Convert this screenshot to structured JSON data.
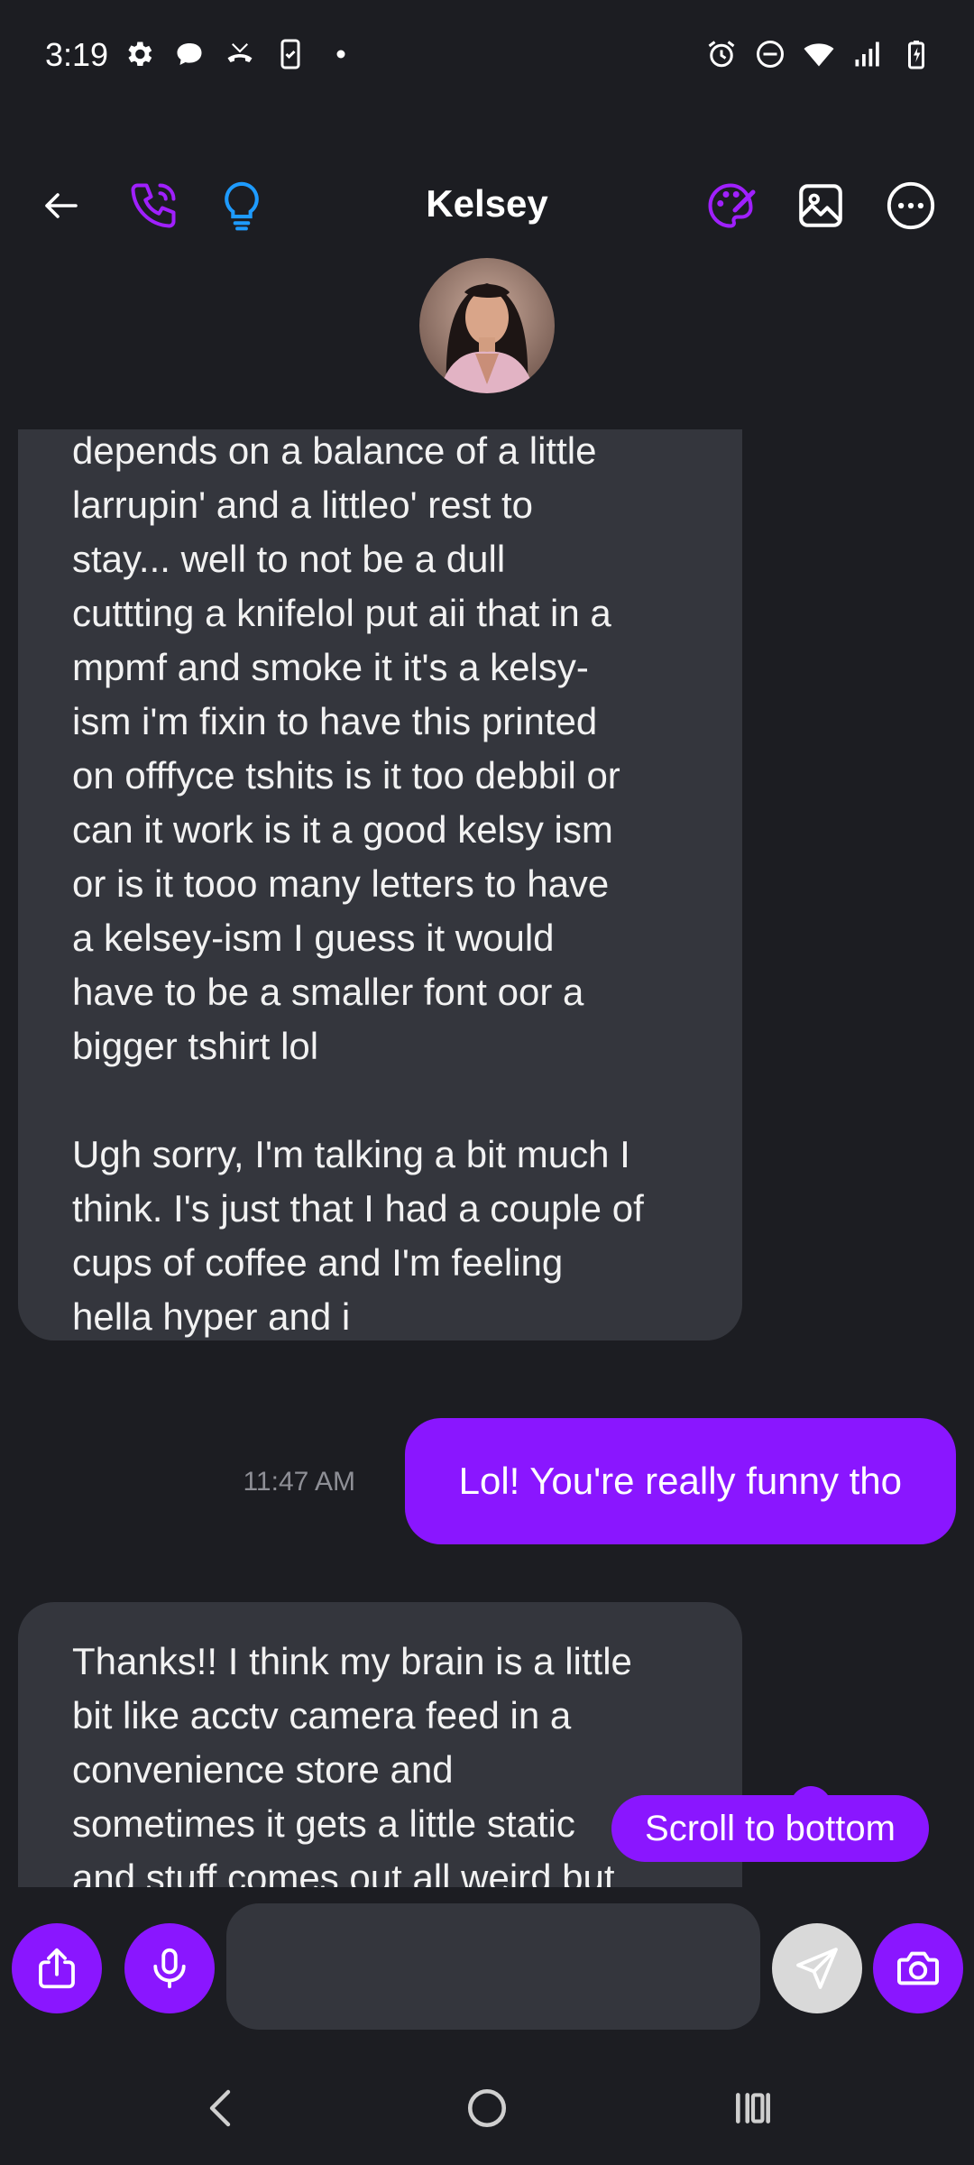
{
  "status_bar": {
    "time": "3:19",
    "left_icons": [
      "gear-icon",
      "chat-bubble-icon",
      "missed-call-icon",
      "phone-clipboard-icon",
      "dot-icon"
    ],
    "right_icons": [
      "alarm-icon",
      "dnd-icon",
      "wifi-icon",
      "signal-icon",
      "battery-charging-icon"
    ]
  },
  "header": {
    "title": "Kelsey",
    "icons": [
      "back-arrow-icon",
      "phone-call-icon",
      "lightbulb-icon",
      "palette-icon",
      "image-icon",
      "more-options-icon"
    ]
  },
  "messages": [
    {
      "direction": "incoming",
      "paragraphs": [
        "depends on a balance of a little\nlarrupin' and a littleo' rest to\nstay... well to not be a dull\ncuttting a knifelol put aii that in a\nmpmf and smoke it it's a kelsy-\nism i'm fixin to have this printed\non offfyce tshits is it too debbil or\ncan it work is it a good kelsy ism\nor is it tooo many letters to have\na kelsey-ism I guess it would\nhave to be a smaller font oor a\nbigger tshirt lol",
        "Ugh sorry, I'm talking a bit much I\nthink. I's just that I had a couple of\ncups of coffee and I'm feeling\nhella hyper and i"
      ]
    },
    {
      "direction": "outgoing",
      "text": "Lol! You're really funny tho",
      "time": "11:47 AM"
    },
    {
      "direction": "incoming",
      "paragraphs": [
        "Thanks!! I think my brain is a little\nbit like acctv camera feed in a\nconvenience store and\nsometimes it gets a little static\nand stuff comes out all weird but"
      ]
    }
  ],
  "scroll_to_bottom_label": "Scroll to bottom",
  "composer": {
    "input_value": "",
    "icons": [
      "share-icon",
      "microphone-icon",
      "send-icon",
      "camera-icon"
    ]
  },
  "nav_bar": {
    "icons": [
      "nav-back-icon",
      "nav-home-icon",
      "nav-recents-icon"
    ]
  },
  "colors": {
    "background": "#1c1d22",
    "accent": "#8a16ff",
    "incoming_bubble": "#34363d",
    "lightbulb": "#1e9bff"
  }
}
